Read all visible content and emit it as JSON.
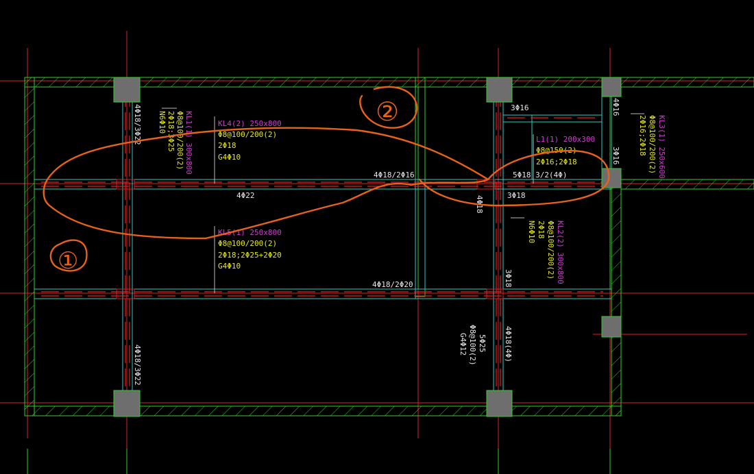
{
  "colors": {
    "background": "#000000",
    "wall": "#2fd12f",
    "axis": "#e02020",
    "beam_edge": "#36c9c9",
    "beam_label": "#d23cd2",
    "rebar_text": "#e6e61e",
    "dimension_text": "#e8e8e8",
    "markup": "#e8621a",
    "column": "#6e6e6e"
  },
  "annotations": {
    "region_1": "①",
    "region_2": "②"
  },
  "beams": {
    "kl4": {
      "name": "KL4(2) 250x800",
      "stirrup": "Φ8@100/200(2)",
      "top": "2Φ18",
      "side": "G4Φ10"
    },
    "kl5": {
      "name": "KL5(1) 250x800",
      "stirrup": "Φ8@100/200(2)",
      "top": "2Φ18;2Φ25+2Φ20",
      "side": "G4Φ10"
    },
    "kl1": {
      "name": "KL1(1) 300x800",
      "stirrup": "Φ8@100/200(2)",
      "top": "2Φ18;3Φ25",
      "side": "N6Φ10"
    },
    "l1": {
      "name": "L1(1) 200x300",
      "stirrup": "Φ8@150(2)",
      "top": "2Φ16;2Φ18"
    },
    "kl2": {
      "name": "KL2(2) 300x800",
      "stirrup": "Φ8@100/200(2)",
      "top": "2Φ18",
      "side": "N6Φ10"
    },
    "kl3": {
      "name": "KL3(1) 250x600",
      "stirrup": "Φ8@100/200(2)",
      "top": "2Φ16;2Φ18"
    },
    "lower": {
      "stirrup": "Φ8@100(2)",
      "top": "5Φ25",
      "side": "G4Φ12"
    }
  },
  "rebar_marks": {
    "bot_4_22": "4Φ22",
    "mid_4_18_2_16": "4Φ18/2Φ16",
    "mid_4_18_2_20": "4Φ18/2Φ20",
    "kl1_top_left": "4Φ18/3Φ22",
    "kl1_bottom_left": "4Φ18/3Φ22",
    "right_5_18": "5Φ18 3/2(4Φ)",
    "right_3_18": "3Φ18",
    "top_3_16": "3Φ16",
    "kl2_4_18": "4Φ18",
    "kl2_3_18": "3Φ18",
    "kl2_lower": "4Φ18(4Φ)",
    "kl3_top": "4Φ16",
    "kl3_bottom": "3Φ16"
  }
}
